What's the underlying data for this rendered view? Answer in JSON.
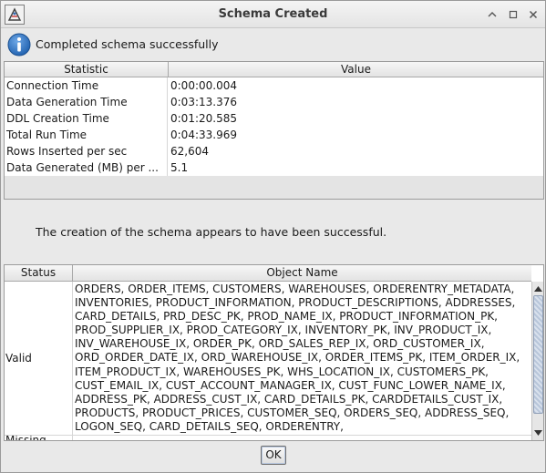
{
  "window": {
    "title": "Schema Created"
  },
  "info": {
    "message": "Completed schema successfully",
    "icon": "info-icon"
  },
  "stats_table": {
    "headers": [
      "Statistic",
      "Value"
    ],
    "rows": [
      {
        "statistic": "Connection Time",
        "value": "0:00:00.004"
      },
      {
        "statistic": "Data Generation Time",
        "value": "0:03:13.376"
      },
      {
        "statistic": "DDL Creation Time",
        "value": "0:01:20.585"
      },
      {
        "statistic": "Total Run Time",
        "value": "0:04:33.969"
      },
      {
        "statistic": "Rows Inserted per sec",
        "value": "62,604"
      },
      {
        "statistic": "Data Generated (MB) per ...",
        "value": "5.1"
      }
    ]
  },
  "result_message": "The creation of the schema appears to have been successful.",
  "objects_table": {
    "headers": [
      "Status",
      "Object Name"
    ],
    "rows": [
      {
        "status": "Valid",
        "objects": "ORDERS, ORDER_ITEMS, CUSTOMERS, WAREHOUSES, ORDERENTRY_METADATA,\nINVENTORIES, PRODUCT_INFORMATION, PRODUCT_DESCRIPTIONS, ADDRESSES,\nCARD_DETAILS, PRD_DESC_PK, PROD_NAME_IX, PRODUCT_INFORMATION_PK,\nPROD_SUPPLIER_IX, PROD_CATEGORY_IX, INVENTORY_PK, INV_PRODUCT_IX,\nINV_WAREHOUSE_IX, ORDER_PK, ORD_SALES_REP_IX, ORD_CUSTOMER_IX,\nORD_ORDER_DATE_IX, ORD_WAREHOUSE_IX, ORDER_ITEMS_PK, ITEM_ORDER_IX,\nITEM_PRODUCT_IX, WAREHOUSES_PK, WHS_LOCATION_IX, CUSTOMERS_PK,\nCUST_EMAIL_IX, CUST_ACCOUNT_MANAGER_IX, CUST_FUNC_LOWER_NAME_IX,\nADDRESS_PK, ADDRESS_CUST_IX, CARD_DETAILS_PK, CARDDETAILS_CUST_IX,\nPRODUCTS, PRODUCT_PRICES, CUSTOMER_SEQ, ORDERS_SEQ, ADDRESS_SEQ,\nLOGON_SEQ, CARD_DETAILS_SEQ, ORDERENTRY,"
      },
      {
        "status": "Missing",
        "objects": ""
      }
    ]
  },
  "buttons": {
    "ok": "OK"
  }
}
